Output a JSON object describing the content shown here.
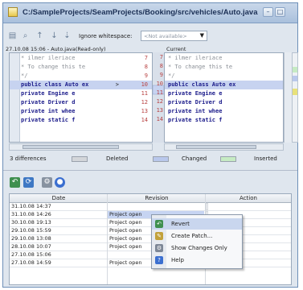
{
  "window": {
    "title": "C:/SampleProjects/SeamProjects/Booking/src/vehicles/Auto.java"
  },
  "toolbar": {
    "icons": [
      "document-icon",
      "search-icon",
      "arrow-up-icon",
      "arrow-down-icon"
    ],
    "ignore_whitespace_label": "Ignore whitespace:",
    "ignore_whitespace_value": "<Not available>"
  },
  "left_pane": {
    "header": "27.10.08 15:06 - Auto.java(Read-only)",
    "lines": [
      {
        "num": "7",
        "code": " * ilmer ileriace",
        "type": "comment"
      },
      {
        "num": "8",
        "code": " * To change this te",
        "type": "comment"
      },
      {
        "num": "9",
        "code": " */",
        "type": "comment"
      },
      {
        "num": "10",
        "code": "public class Auto ex",
        "type": "changed",
        "marker": ">"
      },
      {
        "num": "11",
        "code": "    private Engine e",
        "type": "code"
      },
      {
        "num": "12",
        "code": "    private Driver d",
        "type": "code"
      },
      {
        "num": "13",
        "code": "    private int whee",
        "type": "code"
      },
      {
        "num": "14",
        "code": "    private static f",
        "type": "code"
      }
    ]
  },
  "right_pane": {
    "header": "Current",
    "lines": [
      {
        "num": "7",
        "code": " * ilmer ileriace",
        "type": "comment"
      },
      {
        "num": "8",
        "code": " * To change this te",
        "type": "comment"
      },
      {
        "num": "9",
        "code": " */",
        "type": "comment"
      },
      {
        "num": "10",
        "code": "public class Auto ex",
        "type": "changed"
      },
      {
        "num": "11",
        "code": "    private Engine e",
        "type": "code"
      },
      {
        "num": "12",
        "code": "    private Driver d",
        "type": "code"
      },
      {
        "num": "13",
        "code": "    private int whee",
        "type": "code"
      },
      {
        "num": "14",
        "code": "    private static f",
        "type": "code"
      }
    ]
  },
  "legend": {
    "differences": "3 differences",
    "deleted": "Deleted",
    "changed": "Changed",
    "inserted": "Inserted",
    "colors": {
      "deleted": "#d3d6da",
      "changed": "#b9c8ec",
      "inserted": "#c6ebc3"
    }
  },
  "history_toolbar": {
    "icons": [
      "revert-icon",
      "refresh-icon",
      "settings-icon",
      "help-icon"
    ]
  },
  "table": {
    "columns": [
      "Date",
      "Revision",
      "Action"
    ],
    "rows": [
      {
        "date": "31.10.08 14:37",
        "revision": ""
      },
      {
        "date": "31.10.08 14:26",
        "revision": "Project open",
        "selected": true
      },
      {
        "date": "30.10.08 19:13",
        "revision": "Project open"
      },
      {
        "date": "29.10.08 15:59",
        "revision": "Project open"
      },
      {
        "date": "29.10.08 13:08",
        "revision": "Project open"
      },
      {
        "date": "28.10.08 10:07",
        "revision": "Project open"
      },
      {
        "date": "27.10.08 15:06",
        "revision": ""
      },
      {
        "date": "27.10.08 14:59",
        "revision": "Project open"
      }
    ]
  },
  "context_menu": {
    "items": [
      {
        "label": "Revert",
        "icon": "revert-icon"
      },
      {
        "label": "Create Patch...",
        "icon": "patch-icon"
      },
      {
        "label": "Show Changes Only",
        "icon": "filter-icon"
      },
      {
        "label": "Help",
        "icon": "help-icon"
      }
    ]
  }
}
